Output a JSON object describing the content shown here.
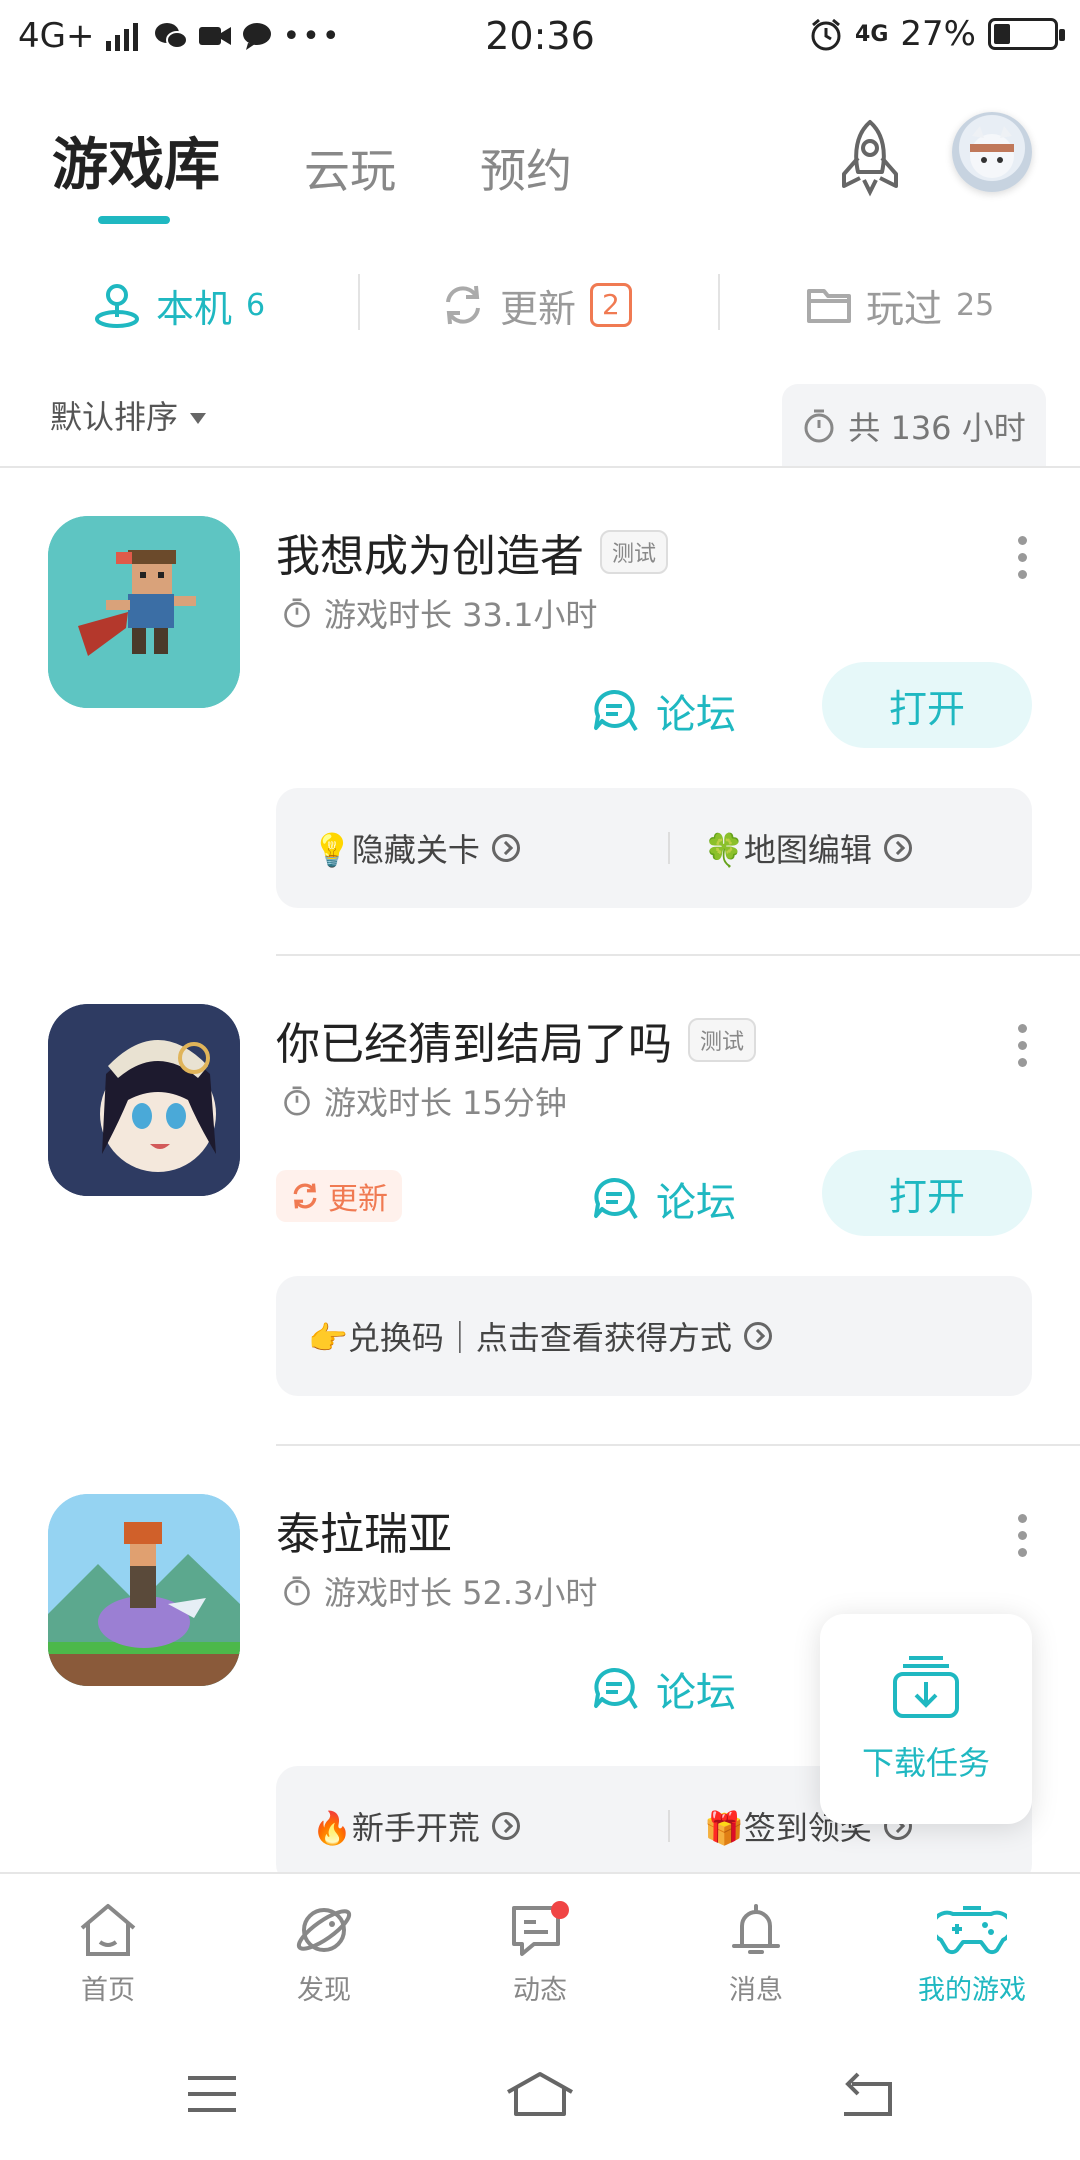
{
  "status_bar": {
    "network": "4G+",
    "time": "20:36",
    "network_right": "4G",
    "battery": "27%",
    "battery_level": 0.27
  },
  "top_tabs": [
    {
      "label": "游戏库",
      "active": true
    },
    {
      "label": "云玩",
      "active": false
    },
    {
      "label": "预约",
      "active": false
    }
  ],
  "sub_tabs": {
    "local": {
      "label": "本机",
      "count": "6"
    },
    "update": {
      "label": "更新",
      "count": "2"
    },
    "played": {
      "label": "玩过",
      "count": "25"
    }
  },
  "sort": {
    "label": "默认排序"
  },
  "total_time": "共 136 小时",
  "games": [
    {
      "title": "我想成为创造者",
      "tag": "测试",
      "playtime": "游戏时长 33.1小时",
      "forum": "论坛",
      "open": "打开",
      "tips": [
        "💡隐藏关卡",
        "🍀地图编辑"
      ]
    },
    {
      "title": "你已经猜到结局了吗",
      "tag": "测试",
      "playtime": "游戏时长 15分钟",
      "update": "更新",
      "forum": "论坛",
      "open": "打开",
      "tips": [
        "👉兑换码｜点击查看获得方式"
      ]
    },
    {
      "title": "泰拉瑞亚",
      "playtime": "游戏时长 52.3小时",
      "forum": "论坛",
      "tips": [
        "🔥新手开荒",
        "🎁签到领奖"
      ]
    }
  ],
  "download_tasks": "下载任务",
  "bottom_nav": [
    {
      "label": "首页",
      "icon": "home-icon"
    },
    {
      "label": "发现",
      "icon": "planet-icon"
    },
    {
      "label": "动态",
      "icon": "feed-icon"
    },
    {
      "label": "消息",
      "icon": "bell-icon"
    },
    {
      "label": "我的游戏",
      "icon": "gamepad-icon",
      "active": true
    }
  ],
  "colors": {
    "accent": "#1fb8c1",
    "update": "#f07a52"
  }
}
